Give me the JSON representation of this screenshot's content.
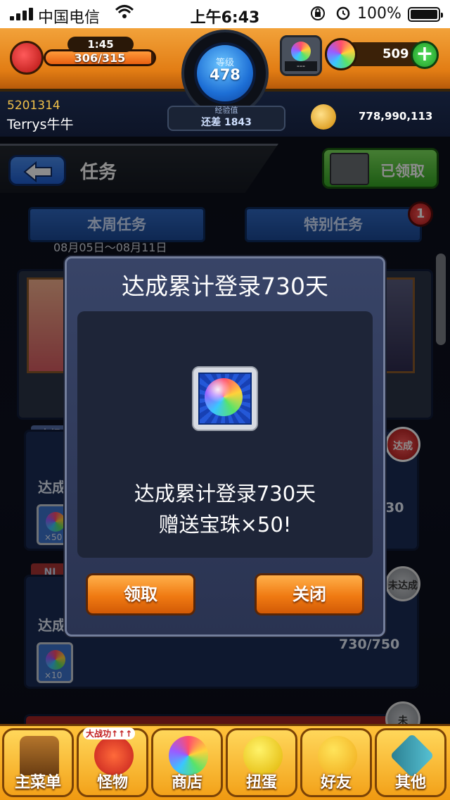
{
  "status_bar": {
    "carrier": "中国电信",
    "time": "上午6:43",
    "battery": "100%"
  },
  "hud": {
    "stamina_timer": "1:45",
    "stamina_value": "306/315",
    "stamina_fraction": 0.971,
    "level_label": "等级",
    "level_value": "478",
    "exp_label": "经验值",
    "exp_remaining": "还差 1843",
    "gacha_placeholder": "---",
    "gems": "509",
    "plus": "+",
    "user_id": "5201314",
    "user_name": "Terrys牛牛",
    "coins": "778,990,113"
  },
  "header": {
    "title": "任务",
    "claimed_button": "已领取"
  },
  "tabs": [
    {
      "label": "本周任务",
      "date": "08月05日～08月11日"
    },
    {
      "label": "特别任务",
      "badge": "1"
    }
  ],
  "list": {
    "tag_unclaimed": "未领",
    "tag_nr": "NI",
    "quest_partial": "达成",
    "quest_b_progress": "30",
    "quest_c_progress": "730/750",
    "reward_count_b": "×50",
    "reward_count_c": "×10",
    "stamp_done": "达成",
    "stamp_not_done": "未达成",
    "stamp_not_done_short": "未"
  },
  "modal": {
    "title": "达成累计登录730天",
    "message_line1": "达成累计登录730天",
    "message_line2": "赠送宝珠×50!",
    "claim_button": "领取",
    "close_button": "关闭"
  },
  "bottom_nav": [
    {
      "label": "主菜单"
    },
    {
      "label": "怪物",
      "ribbon": "大战功↑↑↑"
    },
    {
      "label": "商店"
    },
    {
      "label": "扭蛋"
    },
    {
      "label": "好友"
    },
    {
      "label": "其他"
    }
  ]
}
